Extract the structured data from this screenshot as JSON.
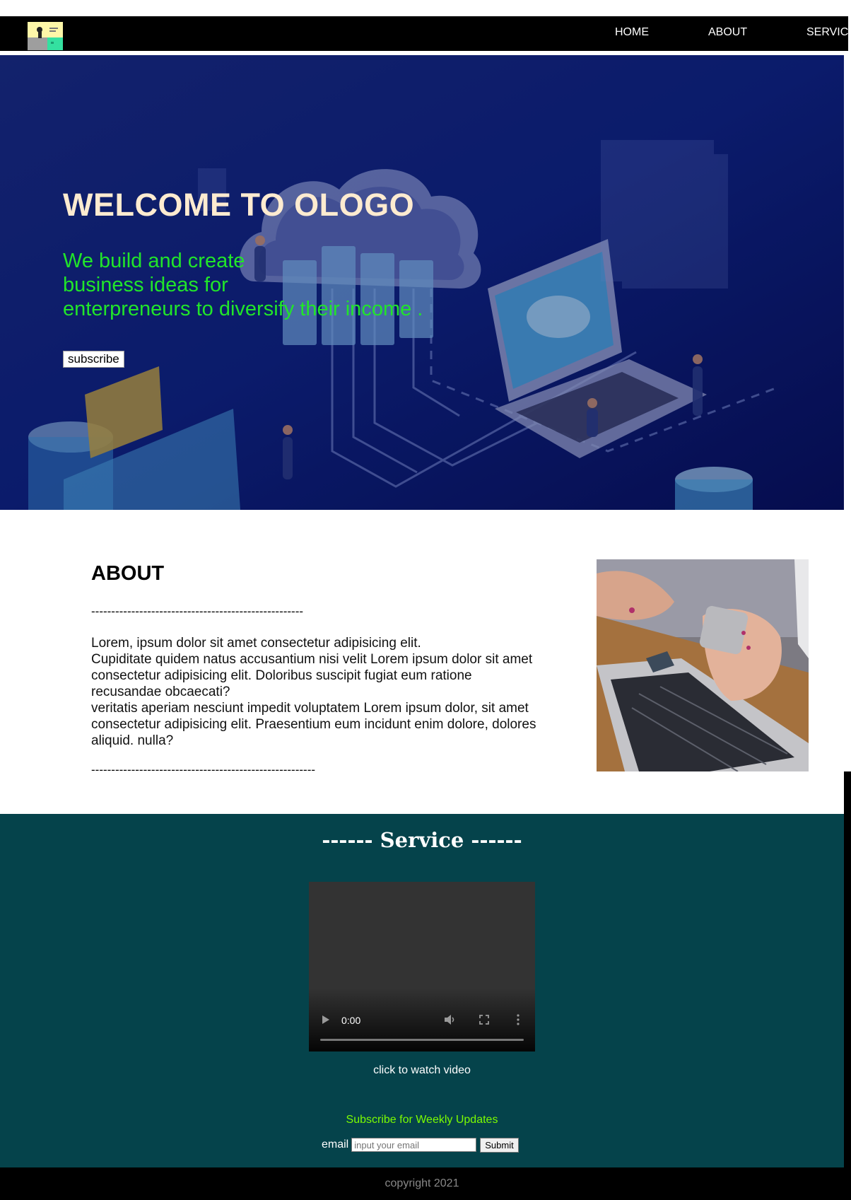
{
  "nav": {
    "items": [
      {
        "label": "HOME"
      },
      {
        "label": "ABOUT"
      },
      {
        "label": "SERVICE"
      }
    ]
  },
  "hero": {
    "title": "WELCOME TO OLOGO",
    "tagline_lines": [
      "We build and create",
      "business ideas for",
      "enterpreneurs to diversify their income ."
    ],
    "subscribe_label": "subscribe"
  },
  "about": {
    "title": "ABOUT",
    "divider_top": "-----------------------------------------------------",
    "paragraph_lines": [
      "Lorem, ipsum dolor sit amet consectetur adipisicing elit.",
      "Cupiditate quidem natus accusantium nisi velit Lorem ipsum dolor sit amet consectetur adipisicing elit. Doloribus suscipit fugiat eum ratione recusandae obcaecati?",
      "veritatis aperiam nesciunt impedit voluptatem Lorem ipsum dolor, sit amet consectetur adipisicing elit. Praesentium eum incidunt enim dolore, dolores aliquid. nulla?"
    ],
    "divider_bottom": "--------------------------------------------------------"
  },
  "service": {
    "title": "------ Service ------",
    "video": {
      "time": "0:00",
      "progress": 0
    },
    "watch_text": "click to watch video",
    "weekly_text": "Subscribe for Weekly Updates",
    "email_label": "email",
    "email_placeholder": "input your email",
    "email_value": "",
    "submit_label": "Submit"
  },
  "footer": {
    "copyright": "copyright 2021"
  },
  "colors": {
    "hero_title": "#fdebd0",
    "hero_tagline": "#21e52a",
    "service_bg": "#05434b",
    "weekly_text": "#7cfc00",
    "copyright": "#888888"
  }
}
